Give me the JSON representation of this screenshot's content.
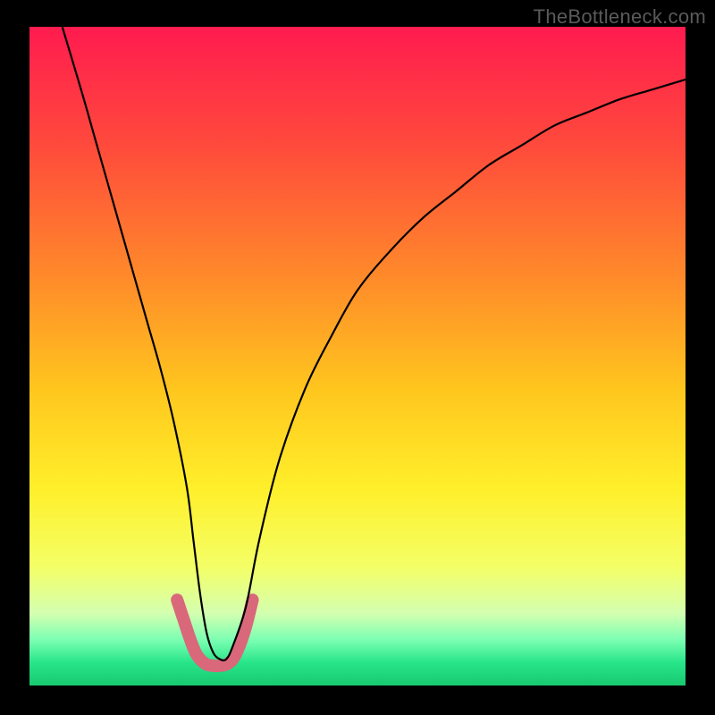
{
  "watermark": "TheBottleneck.com",
  "chart_data": {
    "type": "line",
    "title": "",
    "xlabel": "",
    "ylabel": "",
    "xlim": [
      0,
      100
    ],
    "ylim": [
      0,
      100
    ],
    "series": [
      {
        "name": "bottleneck-curve",
        "x": [
          5,
          8,
          10,
          12,
          14,
          16,
          18,
          20,
          22,
          24,
          25,
          26,
          27,
          28,
          29,
          30,
          31,
          33,
          35,
          38,
          42,
          46,
          50,
          55,
          60,
          65,
          70,
          75,
          80,
          85,
          90,
          95,
          100
        ],
        "y": [
          100,
          90,
          83,
          76,
          69,
          62,
          55,
          48,
          40,
          30,
          22,
          14,
          8,
          5,
          4,
          4,
          6,
          12,
          22,
          34,
          45,
          53,
          60,
          66,
          71,
          75,
          79,
          82,
          85,
          87,
          89,
          90.5,
          92
        ]
      }
    ],
    "highlight_band": {
      "name": "bottom-highlight-pink",
      "x": [
        22.5,
        23.5,
        24.5,
        25.3,
        26,
        27,
        28,
        29,
        30,
        31,
        32,
        33,
        34
      ],
      "y": [
        13,
        10,
        7,
        5,
        4,
        3.2,
        3,
        3,
        3.2,
        4,
        6,
        9,
        13
      ],
      "color": "#d9687a"
    },
    "gradient_stops": [
      {
        "pos": 0.0,
        "color": "#ff1b4f"
      },
      {
        "pos": 0.18,
        "color": "#ff4a3c"
      },
      {
        "pos": 0.38,
        "color": "#ff8a2a"
      },
      {
        "pos": 0.55,
        "color": "#ffc61e"
      },
      {
        "pos": 0.7,
        "color": "#ffef2a"
      },
      {
        "pos": 0.82,
        "color": "#f4ff66"
      },
      {
        "pos": 0.89,
        "color": "#d4ffb0"
      },
      {
        "pos": 0.93,
        "color": "#7dffb3"
      },
      {
        "pos": 0.965,
        "color": "#28e58a"
      },
      {
        "pos": 1.0,
        "color": "#18c96f"
      }
    ]
  }
}
